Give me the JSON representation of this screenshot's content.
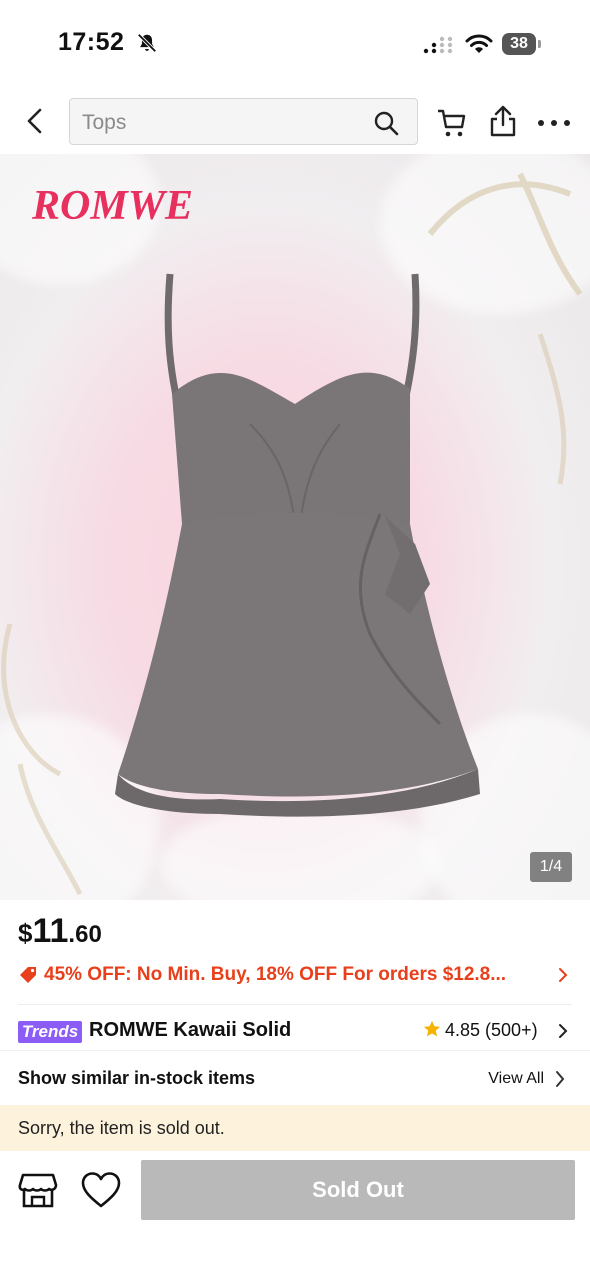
{
  "status_bar": {
    "time": "17:52",
    "battery": "38"
  },
  "header": {
    "search_text": "Tops"
  },
  "product_image": {
    "brand_logo": "ROMWE",
    "counter": "1/4"
  },
  "price": {
    "currency": "$",
    "main": "11",
    "cents": ".60"
  },
  "promo": {
    "text": "45% OFF: No Min. Buy,  18% OFF For orders $12.8..."
  },
  "title": {
    "badge": "Trends",
    "name": "ROMWE Kawaii Solid",
    "rating": "4.85 (500+)"
  },
  "similar": {
    "label": "Show similar in-stock items",
    "view_all": "View All"
  },
  "notice": {
    "text": "Sorry, the item is sold out."
  },
  "actions": {
    "button_label": "Sold Out"
  },
  "colors": {
    "brand": "#e8305f",
    "promo": "#e8401c",
    "trends": "#8b5cf6",
    "star": "#f5b301",
    "notice_bg": "#fdf3dc",
    "button_disabled": "#b9b9b9"
  },
  "icons": [
    "bell-off-icon",
    "signal-icon",
    "wifi-icon",
    "battery-icon",
    "back-icon",
    "search-icon",
    "cart-icon",
    "share-icon",
    "more-icon",
    "tag-icon",
    "star-icon",
    "chevron-right-icon",
    "store-icon",
    "heart-icon"
  ]
}
